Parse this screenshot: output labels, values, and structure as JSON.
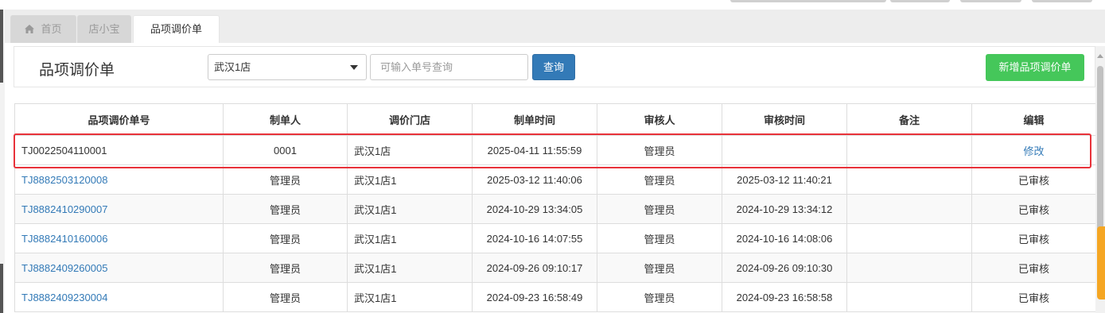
{
  "tabs": [
    {
      "label": "首页",
      "icon": "home-icon"
    },
    {
      "label": "店小宝"
    },
    {
      "label": "品项调价单"
    }
  ],
  "header": {
    "title": "品项调价单",
    "store_select": {
      "value": "武汉1店"
    },
    "search": {
      "placeholder": "可输入单号查询",
      "value": ""
    },
    "query_label": "查询",
    "add_label": "新增品项调价单"
  },
  "colors": {
    "primary": "#337ab7",
    "success": "#45c75a",
    "highlight": "#e8323a"
  },
  "table": {
    "columns": [
      "品项调价单号",
      "制单人",
      "调价门店",
      "制单时间",
      "审核人",
      "审核时间",
      "备注",
      "编辑"
    ],
    "rows": [
      {
        "no": "TJ0022504110001",
        "creator": "0001",
        "store": "武汉1店",
        "created": "2025-04-11 11:55:59",
        "auditor": "管理员",
        "audited": "",
        "remark": "",
        "action": "修改"
      },
      {
        "no": "TJ8882503120008",
        "creator": "管理员",
        "store": "武汉1店1",
        "created": "2025-03-12 11:40:06",
        "auditor": "管理员",
        "audited": "2025-03-12 11:40:21",
        "remark": "",
        "action": "已审核"
      },
      {
        "no": "TJ8882410290007",
        "creator": "管理员",
        "store": "武汉1店1",
        "created": "2024-10-29 13:34:05",
        "auditor": "管理员",
        "audited": "2024-10-29 13:34:12",
        "remark": "",
        "action": "已审核"
      },
      {
        "no": "TJ8882410160006",
        "creator": "管理员",
        "store": "武汉1店1",
        "created": "2024-10-16 14:07:55",
        "auditor": "管理员",
        "audited": "2024-10-16 14:08:06",
        "remark": "",
        "action": "已审核"
      },
      {
        "no": "TJ8882409260005",
        "creator": "管理员",
        "store": "武汉1店1",
        "created": "2024-09-26 09:10:17",
        "auditor": "管理员",
        "audited": "2024-09-26 09:10:30",
        "remark": "",
        "action": "已审核"
      },
      {
        "no": "TJ8882409230004",
        "creator": "管理员",
        "store": "武汉1店1",
        "created": "2024-09-23 16:58:49",
        "auditor": "管理员",
        "audited": "2024-09-23 16:58:58",
        "remark": "",
        "action": "已审核"
      }
    ]
  }
}
